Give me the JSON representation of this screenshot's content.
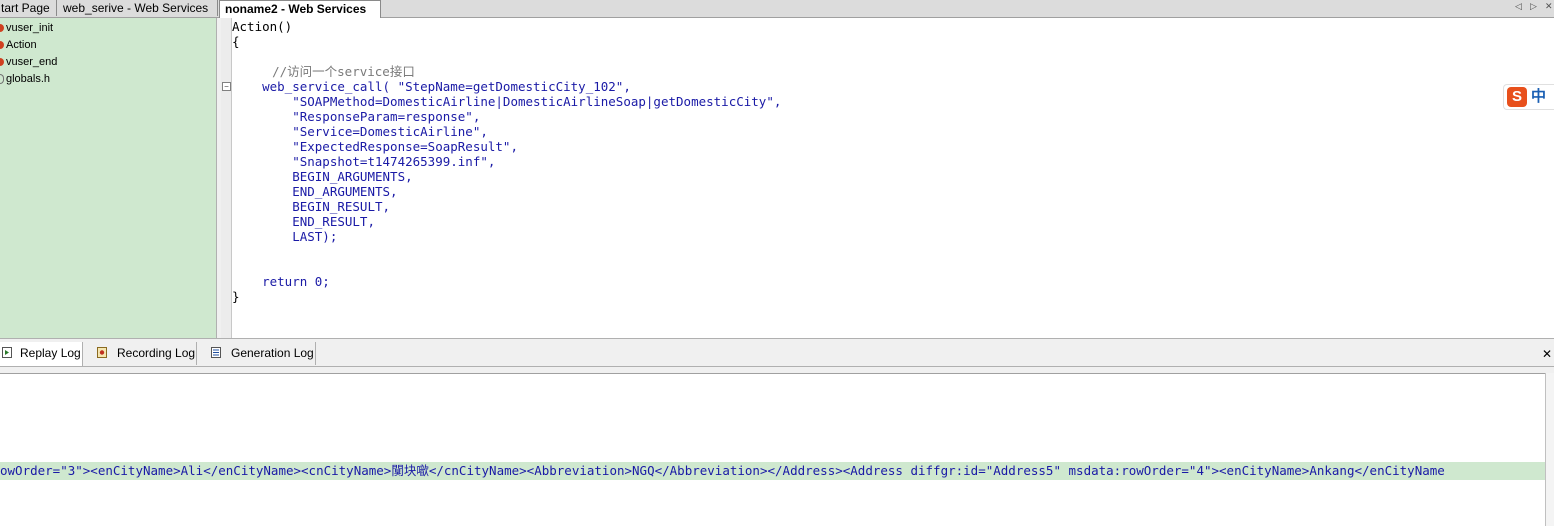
{
  "doc_tabs": [
    {
      "label": "tart Page"
    },
    {
      "label": "web_serive - Web Services"
    },
    {
      "label": "noname2 - Web Services"
    }
  ],
  "tab_nav": {
    "prev": "◁",
    "next": "▷",
    "close": "✕"
  },
  "tree_items": [
    {
      "label": "vuser_init"
    },
    {
      "label": "Action"
    },
    {
      "label": "vuser_end"
    },
    {
      "label": "globals.h"
    }
  ],
  "fold_symbol": "−",
  "code_lines": [
    "Action()",
    "{",
    "    //访问一个service接口",
    "    web_service_call( \"StepName=getDomesticCity_102\",",
    "        \"SOAPMethod=DomesticAirline|DomesticAirlineSoap|getDomesticCity\",",
    "        \"ResponseParam=response\",",
    "        \"Service=DomesticAirline\",",
    "        \"ExpectedResponse=SoapResult\",",
    "        \"Snapshot=t1474265399.inf\",",
    "        BEGIN_ARGUMENTS,",
    "        END_ARGUMENTS,",
    "        BEGIN_RESULT,",
    "        END_RESULT,",
    "        LAST);",
    "    return 0;",
    "}"
  ],
  "ime": {
    "badge": "S",
    "label": "中"
  },
  "log_tabs": [
    {
      "label": "Replay Log"
    },
    {
      "label": "Recording Log"
    },
    {
      "label": "Generation Log"
    }
  ],
  "log_close": "✕",
  "log_line": "owOrder=\"3\"><enCityName>Ali</enCityName><cnCityName>闃块噷</cnCityName><Abbreviation>NGQ</Abbreviation></Address><Address diffgr:id=\"Address5\" msdata:rowOrder=\"4\"><enCityName>Ankang</enCityName"
}
